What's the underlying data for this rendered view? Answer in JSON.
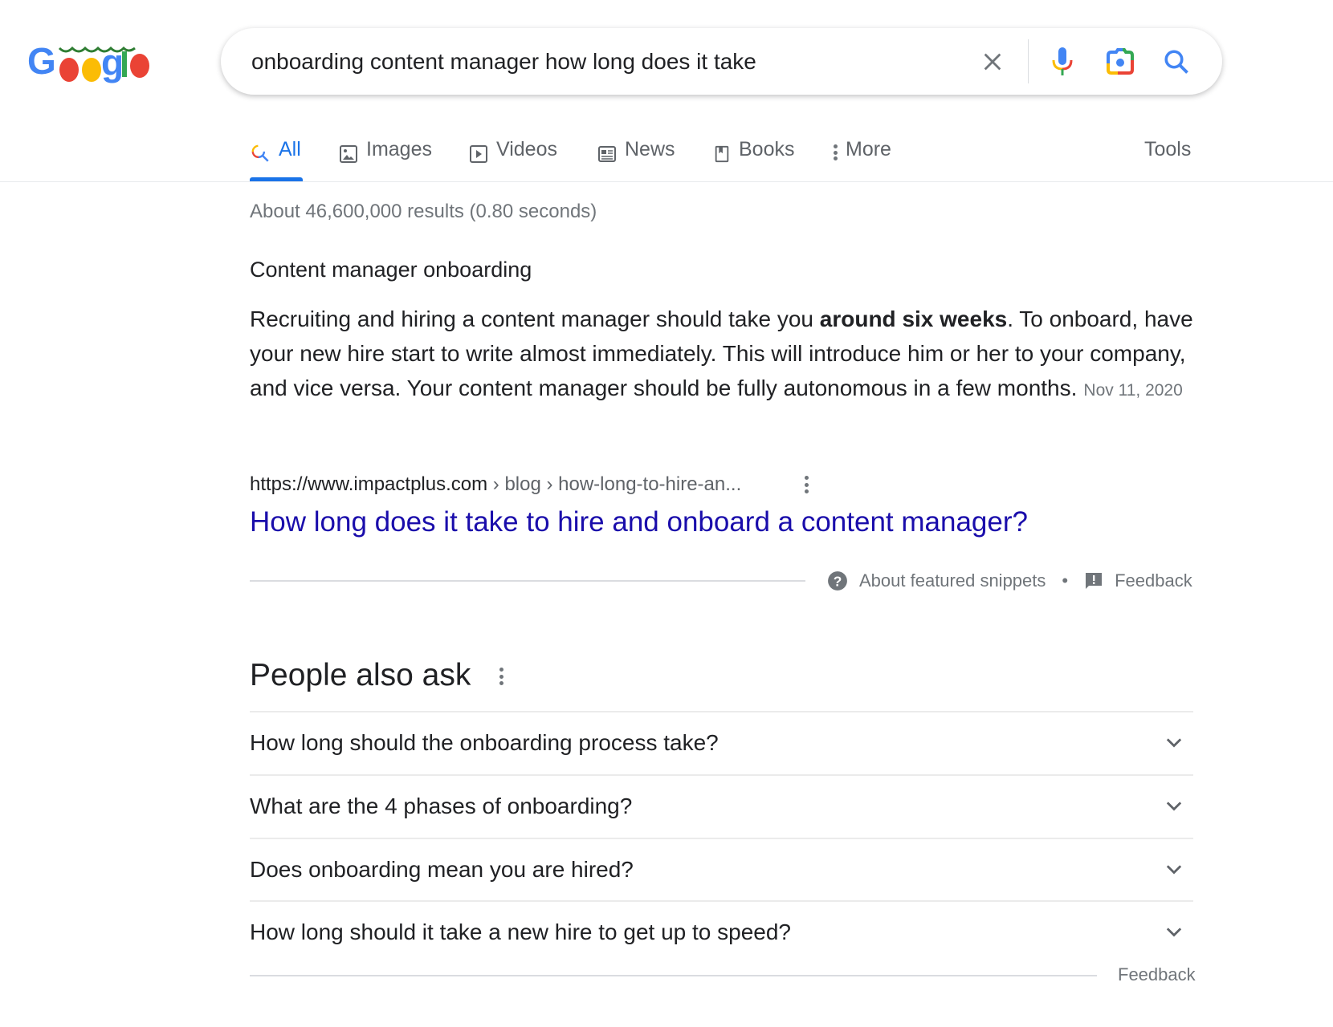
{
  "logo": {
    "text": "Google",
    "colors": [
      "#4285f4",
      "#ea4335",
      "#fbbc05",
      "#4285f4",
      "#34a853",
      "#ea4335"
    ]
  },
  "search": {
    "query": "onboarding content manager how long does it take",
    "icons": [
      "clear-icon",
      "microphone-icon",
      "camera-lens-icon",
      "search-icon"
    ]
  },
  "tabs": [
    {
      "label": "All",
      "icon": "search-icon",
      "active": true
    },
    {
      "label": "Images",
      "icon": "image-icon"
    },
    {
      "label": "Videos",
      "icon": "play-icon"
    },
    {
      "label": "News",
      "icon": "newspaper-icon"
    },
    {
      "label": "Books",
      "icon": "book-icon"
    },
    {
      "label": "More",
      "icon": "more-vert-icon"
    }
  ],
  "tools_label": "Tools",
  "result_stats": "About 46,600,000 results (0.80 seconds)",
  "snippet": {
    "heading": "Content manager onboarding",
    "text_before": "Recruiting and hiring a content manager should take you ",
    "text_bold": "around six weeks",
    "text_after": ". To onboard, have your new hire start to write almost immediately. This will introduce him or her to your company, and vice versa. Your content manager should be fully autonomous in a few months.",
    "date": "Nov 11, 2020",
    "cite_domain": "https://www.impactplus.com",
    "cite_path": " › blog › how-long-to-hire-an...",
    "title": "How long does it take to hire and onboard a content manager?",
    "about_label": "About featured snippets",
    "separator": "•",
    "feedback_label": "Feedback"
  },
  "paa": {
    "heading": "People also ask",
    "questions": [
      "How long should the onboarding process take?",
      "What are the 4 phases of onboarding?",
      "Does onboarding mean you are hired?",
      "How long should it take a new hire to get up to speed?"
    ],
    "feedback_label": "Feedback"
  },
  "colors": {
    "accent": "#1a73e8",
    "link": "#1a0dab",
    "secondary_text": "#70757a"
  }
}
